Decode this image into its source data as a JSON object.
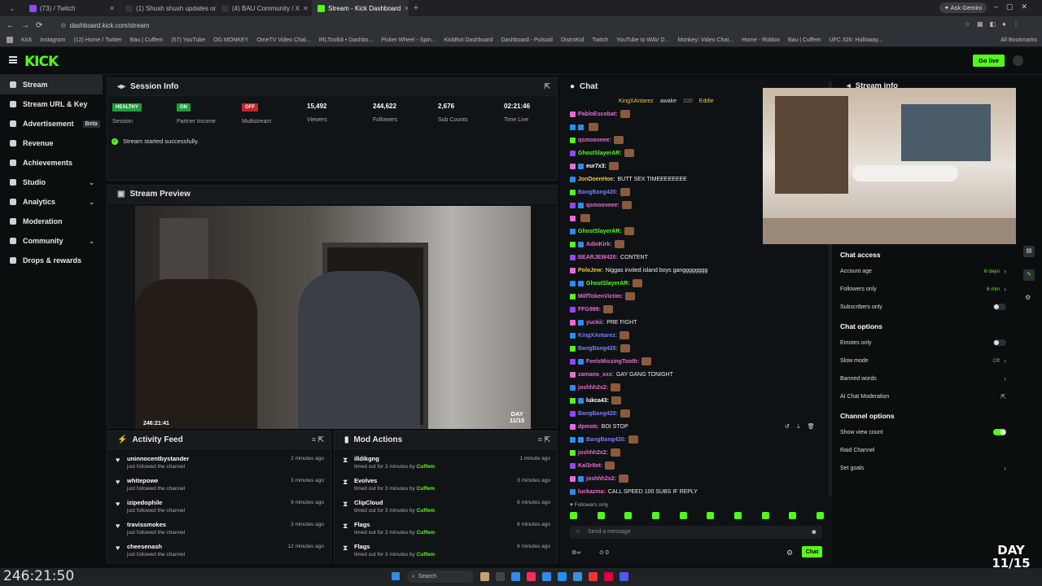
{
  "browser": {
    "tabs": [
      {
        "label": "(73) / Twitch",
        "color": "#9146ff"
      },
      {
        "label": "(1) Shush shush updates on...",
        "color": "#333"
      },
      {
        "label": "(4) BAU Community / X",
        "color": "#333"
      },
      {
        "label": "Stream - Kick Dashboard",
        "color": "#53fc18"
      }
    ],
    "ask_gemini": "Ask Gemini",
    "url": "dashboard.kick.com/stream",
    "bookmarks": [
      "Kick",
      "Instagram",
      "(12) Home / Twitter",
      "Bau | Cuffem",
      "(57) YouTube",
      "OG MONKEY",
      "OmeTV Video Chat...",
      "IRLToolkit • Dashbo...",
      "Picker Wheel - Spin...",
      "KickBot Dashboard",
      "Dashboard - Pulsoid",
      "DistroKid",
      "Twitch",
      "YouTube to WAV D...",
      "Monkey: Video Chat...",
      "Home - Roblox",
      "Bau | Cuffem",
      "UFC 326: Holloway..."
    ],
    "all_bookmarks": "All Bookmarks"
  },
  "nav": {
    "logo": "KICK",
    "go_live": "Go live"
  },
  "sidebar": {
    "items": [
      {
        "label": "Stream",
        "active": true
      },
      {
        "label": "Stream URL & Key"
      },
      {
        "label": "Advertisement",
        "badge": "Beta"
      },
      {
        "label": "Revenue"
      },
      {
        "label": "Achievements"
      },
      {
        "label": "Studio",
        "chevron": true
      },
      {
        "label": "Analytics",
        "chevron": true
      },
      {
        "label": "Moderation"
      },
      {
        "label": "Community",
        "chevron": true
      },
      {
        "label": "Drops & rewards"
      }
    ]
  },
  "session": {
    "title": "Session Info",
    "stats": [
      {
        "value": "HEALTHY",
        "label": "Session",
        "badge": "#1f9d3a"
      },
      {
        "value": "ON",
        "label": "Partner Income",
        "badge": "#1f9d3a"
      },
      {
        "value": "OFF",
        "label": "Multistream",
        "badge": "#c0282a"
      },
      {
        "value": "15,492",
        "label": "Viewers"
      },
      {
        "value": "244,622",
        "label": "Followers"
      },
      {
        "value": "2,676",
        "label": "Sub Counts"
      },
      {
        "value": "02:21:46",
        "label": "Time Live"
      }
    ],
    "status": "Stream started successfully."
  },
  "preview": {
    "title": "Stream Preview",
    "timestamp": "246:21:41",
    "day_label": "DAY",
    "day_num": "11/15"
  },
  "activity": {
    "title": "Activity Feed",
    "items": [
      {
        "name": "uninnocentbystander",
        "sub": "just followed the channel",
        "time": "2 minutes ago"
      },
      {
        "name": "whitepowe",
        "sub": "just followed the channel",
        "time": "3 minutes ago"
      },
      {
        "name": "izipedophile",
        "sub": "just followed the channel",
        "time": "9 minutes ago"
      },
      {
        "name": "travissmokes",
        "sub": "just followed the channel",
        "time": "3 minutes ago"
      },
      {
        "name": "cheesenash",
        "sub": "just followed the channel",
        "time": "12 minutes ago"
      }
    ]
  },
  "mod": {
    "title": "Mod Actions",
    "by": "Cuffem",
    "items": [
      {
        "name": "illdikgng",
        "sub": "timed out for 3 minutes by",
        "time": "1 minute ago"
      },
      {
        "name": "Evolves",
        "sub": "timed out for 3 minutes by",
        "time": "3 minutes ago"
      },
      {
        "name": "ClipCloud",
        "sub": "timed out for 3 minutes by",
        "time": "6 minutes ago"
      },
      {
        "name": "Flags",
        "sub": "timed out for 3 minutes by",
        "time": "6 minutes ago"
      },
      {
        "name": "Flags",
        "sub": "timed out for 3 minutes by",
        "time": "6 minutes ago"
      }
    ]
  },
  "chat": {
    "title": "Chat",
    "pinned": [
      "KingXAntarez",
      "awake",
      "Eddie"
    ],
    "pinned_count": "100",
    "messages": [
      {
        "user": "PabloEscobat:",
        "color": "#e86bd3",
        "text": ""
      },
      {
        "user": "",
        "color": "#e86bd3",
        "text": ""
      },
      {
        "user": "qsmooveee:",
        "color": "#e86bd3",
        "text": ""
      },
      {
        "user": "GhostSlayerAR:",
        "color": "#53fc18",
        "text": ""
      },
      {
        "user": "eur7x3:",
        "color": "#ffffff",
        "text": ""
      },
      {
        "user": "JonDoenHoe:",
        "color": "#f5c542",
        "text": "BUTT SEX TIMEEEEEEEE"
      },
      {
        "user": "BangBang420:",
        "color": "#7a7aff",
        "text": ""
      },
      {
        "user": "qsmooveee:",
        "color": "#e86bd3",
        "text": ""
      },
      {
        "user": "",
        "color": "#e86bd3",
        "text": ""
      },
      {
        "user": "GhostSlayerAR:",
        "color": "#53fc18",
        "text": ""
      },
      {
        "user": "AdinKirk:",
        "color": "#e86bd3",
        "text": ""
      },
      {
        "user": "BEARJEW420:",
        "color": "#e86bd3",
        "text": "CONTENT"
      },
      {
        "user": "PoloJew:",
        "color": "#f5c542",
        "text": "Niggas invited island boys gangggggggg"
      },
      {
        "user": "GhostSlayerAR:",
        "color": "#53fc18",
        "text": ""
      },
      {
        "user": "MilfTokenVictim:",
        "color": "#e86bd3",
        "text": ""
      },
      {
        "user": "FFG999:",
        "color": "#e86bd3",
        "text": ""
      },
      {
        "user": "yuckii:",
        "color": "#e86bd3",
        "text": "PRE FIGHT"
      },
      {
        "user": "KingXAntarez:",
        "color": "#7a7aff",
        "text": ""
      },
      {
        "user": "BangBang420:",
        "color": "#7a7aff",
        "text": ""
      },
      {
        "user": "FeelsMissingTooth:",
        "color": "#e86bd3",
        "text": ""
      },
      {
        "user": "zamano_xxx:",
        "color": "#e86bd3",
        "text": "GAY GANG TONIGHT"
      },
      {
        "user": "joshhh2x2:",
        "color": "#e86bd3",
        "text": ""
      },
      {
        "user": "lukca43:",
        "color": "#ffffff",
        "text": ""
      },
      {
        "user": "BangBang420:",
        "color": "#7a7aff",
        "text": ""
      },
      {
        "user": "dpmob:",
        "color": "#e86bd3",
        "text": "BOI STOP"
      },
      {
        "user": "BangBang420:",
        "color": "#7a7aff",
        "text": ""
      },
      {
        "user": "joshhh2x2:",
        "color": "#e86bd3",
        "text": ""
      },
      {
        "user": "Kal3r8ot:",
        "color": "#e86bd3",
        "text": ""
      },
      {
        "user": "joshhh2x2:",
        "color": "#e86bd3",
        "text": ""
      },
      {
        "user": "luckazma:",
        "color": "#e86bd3",
        "text": "CALL SPEED 100 SUBS IF REPLY"
      }
    ],
    "followers_only": "Followers only",
    "placeholder": "Send a message",
    "count": "0",
    "send": "Chat"
  },
  "stream_info_title": "Stream info",
  "settings": {
    "access_title": "Chat access",
    "account_age": {
      "label": "Account age",
      "value": "6 days"
    },
    "followers_only": {
      "label": "Followers only",
      "value": "6 min"
    },
    "subs_only": {
      "label": "Subscribers only"
    },
    "options_title": "Chat options",
    "emotes_only": {
      "label": "Emotes only"
    },
    "slow_mode": {
      "label": "Slow mode",
      "value": "Off"
    },
    "banned_words": {
      "label": "Banned words"
    },
    "ai_mod": {
      "label": "AI Chat Moderation"
    },
    "channel_title": "Channel options",
    "show_view_count": {
      "label": "Show view count"
    },
    "raid_channel": {
      "label": "Raid Channel"
    },
    "set_goals": {
      "label": "Set goals"
    }
  },
  "overlay": {
    "clock": "246:21:50",
    "day_label": "DAY",
    "day_num": "11/15"
  },
  "taskbar": {
    "search": "Search"
  }
}
